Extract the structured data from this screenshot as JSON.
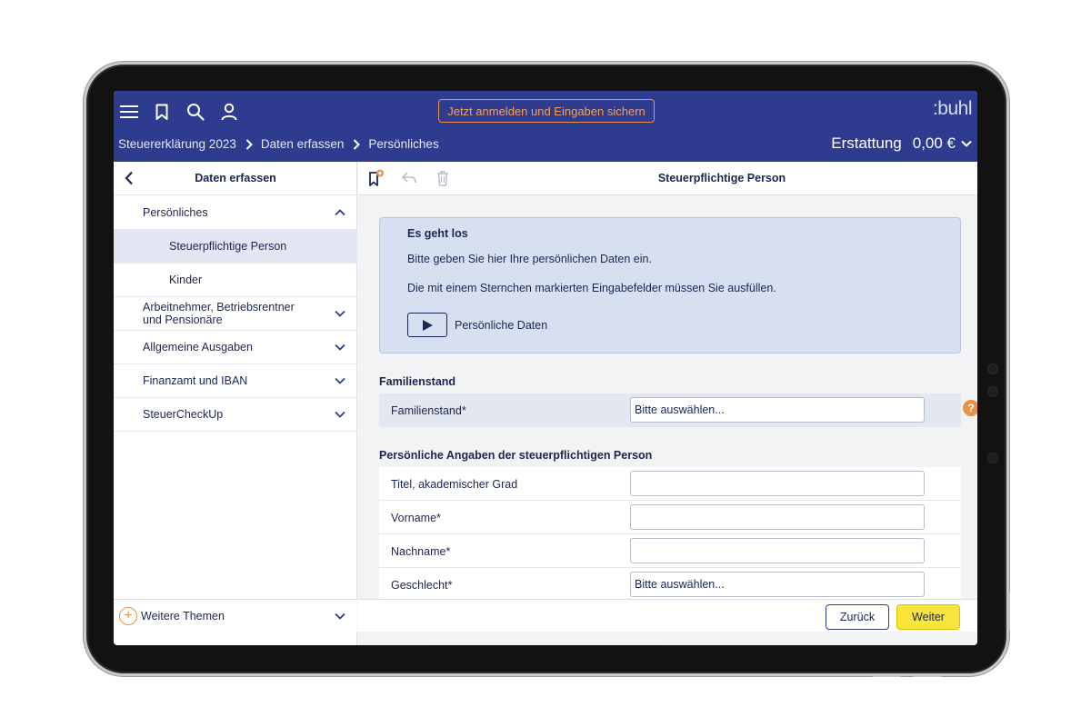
{
  "header": {
    "menu_icon": "menu-icon",
    "bookmark_icon": "bookmark-icon",
    "search_icon": "search-icon",
    "user_icon": "user-icon",
    "login_button_label": "Jetzt anmelden und Eingaben sichern",
    "brand": ":buhl",
    "breadcrumb": [
      "Steuererklärung 2023",
      "Daten erfassen",
      "Persönliches"
    ],
    "refund_label": "Erstattung",
    "refund_value": "0,00 €"
  },
  "sidebar": {
    "title": "Daten erfassen",
    "items": [
      {
        "label": "Persönliches",
        "chevron": "up"
      },
      {
        "label": "Steuerpflichtige Person",
        "active": true
      },
      {
        "label": "Kinder"
      },
      {
        "label": "Arbeitnehmer, Betriebsrentner und Pensionäre",
        "chevron": "down"
      },
      {
        "label": "Allgemeine Ausgaben",
        "chevron": "down"
      },
      {
        "label": "Finanzamt und IBAN",
        "chevron": "down"
      },
      {
        "label": "SteuerCheckUp",
        "chevron": "down"
      }
    ],
    "footer_label": "Weitere Themen"
  },
  "main": {
    "title": "Steuerpflichtige Person",
    "intro": {
      "title": "Es geht los",
      "line1": "Bitte geben Sie hier Ihre persönlichen Daten ein.",
      "line2": "Die mit einem Sternchen markierten Eingabefelder müssen Sie ausfüllen.",
      "video_label": "Persönliche Daten"
    },
    "section1": {
      "title": "Familienstand",
      "rows": [
        {
          "label": "Familienstand*",
          "value": "Bitte auswählen..."
        }
      ]
    },
    "section2": {
      "title": "Persönliche Angaben der steuerpflichtigen Person",
      "rows": [
        {
          "label": "Titel, akademischer Grad",
          "value": ""
        },
        {
          "label": "Vorname*",
          "value": ""
        },
        {
          "label": "Nachname*",
          "value": ""
        },
        {
          "label": "Geschlecht*",
          "value": "Bitte auswählen..."
        }
      ]
    },
    "help_symbol": "?",
    "back_label": "Zurück",
    "next_label": "Weiter"
  },
  "colors": {
    "header_bg": "#2e3b8e",
    "accent_orange": "#e8924a",
    "next_yellow": "#f7e53c",
    "text_navy": "#1c2554"
  }
}
